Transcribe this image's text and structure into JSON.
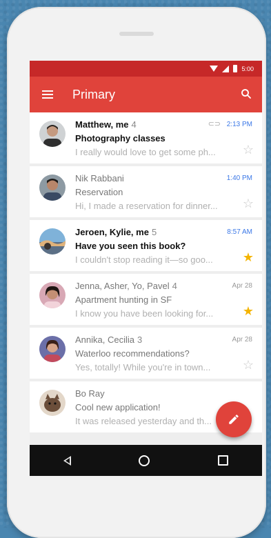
{
  "status_bar": {
    "time": "5:00"
  },
  "app_bar": {
    "title": "Primary"
  },
  "emails": [
    {
      "from": "Matthew, me",
      "count": "4",
      "subject": "Photography classes",
      "snippet": "I really would love to get some ph...",
      "time": "2:13 PM",
      "unread": true,
      "starred": false,
      "time_highlight": true,
      "attachment": true
    },
    {
      "from": "Nik Rabbani",
      "count": "",
      "subject": "Reservation",
      "snippet": "Hi, I made a reservation for dinner...",
      "time": "1:40 PM",
      "unread": false,
      "starred": false,
      "time_highlight": true,
      "attachment": false
    },
    {
      "from": "Jeroen, Kylie, me",
      "count": "5",
      "subject": "Have you seen this book?",
      "snippet": "I couldn't stop reading it—so goo...",
      "time": "8:57 AM",
      "unread": true,
      "starred": true,
      "time_highlight": true,
      "attachment": false
    },
    {
      "from": "Jenna, Asher, Yo, Pavel",
      "count": "4",
      "subject": "Apartment hunting in SF",
      "snippet": "I know you have been looking for...",
      "time": "Apr 28",
      "unread": false,
      "starred": true,
      "time_highlight": false,
      "attachment": false
    },
    {
      "from": "Annika, Cecilia",
      "count": "3",
      "subject": "Waterloo recommendations?",
      "snippet": "Yes, totally! While you're in town...",
      "time": "Apr 28",
      "unread": false,
      "starred": false,
      "time_highlight": false,
      "attachment": false
    },
    {
      "from": "Bo Ray",
      "count": "",
      "subject": "Cool new application!",
      "snippet": "It was released yesterday and th...",
      "time": "",
      "unread": false,
      "starred": false,
      "time_highlight": false,
      "attachment": false
    }
  ],
  "icons": {
    "menu": "menu-icon",
    "search": "search-icon",
    "compose": "pencil-icon",
    "star": "star-icon",
    "attachment": "paperclip-icon"
  },
  "colors": {
    "app_bar": "#e0433b",
    "status_bar": "#c62828",
    "star_on": "#f4b400",
    "time_blue": "#3b78e7"
  }
}
